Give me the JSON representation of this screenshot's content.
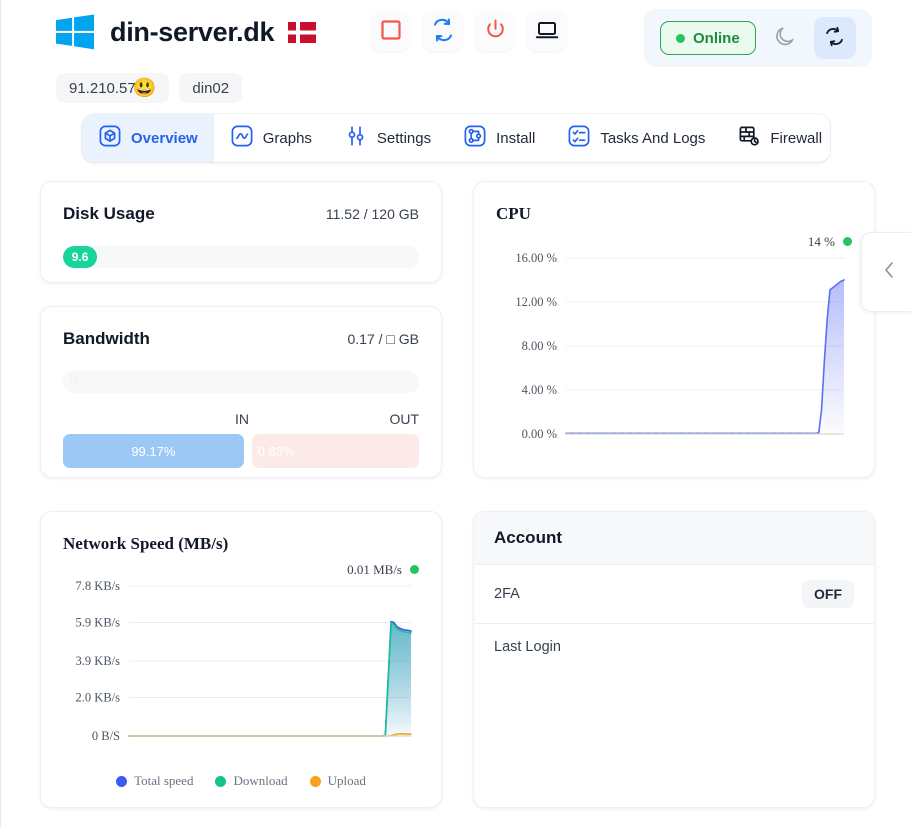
{
  "header": {
    "brand_title": "din-server.dk",
    "logo_icon": "windows-logo",
    "flag_icon": "denmark-flag",
    "actions": [
      {
        "name": "stop-button",
        "icon": "stop-square-icon"
      },
      {
        "name": "restart-button",
        "icon": "restart-icon"
      },
      {
        "name": "power-button",
        "icon": "power-icon"
      },
      {
        "name": "console-button",
        "icon": "monitor-icon"
      }
    ],
    "status": {
      "label": "Online",
      "dot_color": "#22c55e",
      "text_color": "#1c8c3c",
      "dark_mode_icon": "moon-icon",
      "refresh_icon": "sync-icon"
    }
  },
  "chips": [
    {
      "label": "91.210.57",
      "emoji": "😃"
    },
    {
      "label": "din02",
      "emoji": ""
    }
  ],
  "tabs": [
    {
      "label": "Overview",
      "icon": "cube-icon",
      "active": true
    },
    {
      "label": "Graphs",
      "icon": "wave-icon",
      "active": false
    },
    {
      "label": "Settings",
      "icon": "sliders-icon",
      "active": false
    },
    {
      "label": "Install",
      "icon": "nodes-icon",
      "active": false
    },
    {
      "label": "Tasks And Logs",
      "icon": "checklist-icon",
      "active": false
    },
    {
      "label": "Firewall",
      "icon": "firewall-icon",
      "active": false
    }
  ],
  "tab_caret_icon": "chevron-down-icon",
  "disk": {
    "title": "Disk Usage",
    "value": "11.52 / 120 GB",
    "bar_label": "9.6",
    "percent": 9.6,
    "bar_color": "#18d498"
  },
  "bandwidth": {
    "title": "Bandwidth",
    "value": "0.17 / □ GB",
    "track_label": "0",
    "percent": 0,
    "in_label": "IN",
    "out_label": "OUT",
    "in_value": "99.17%",
    "out_value": "0.83%",
    "in_percent": 99.17,
    "out_percent": 0.83,
    "in_color": "#9cc8f5",
    "out_color": "#fbeae8"
  },
  "account": {
    "title": "Account",
    "rows": [
      {
        "label": "2FA",
        "value": "OFF"
      },
      {
        "label": "Last Login",
        "value": ""
      }
    ]
  },
  "drawer": {
    "icon": "chevron-left-icon"
  },
  "chart_data": [
    {
      "type": "area",
      "name": "cpu",
      "title": "CPU",
      "current_label": "14 %",
      "current_value": 14,
      "dot_color": "#22c55e",
      "line_color": "#5b6ef5",
      "fill_color": "#c7cffa",
      "ylabel": "",
      "xlabel": "",
      "ylim": [
        0,
        16
      ],
      "ytick_labels": [
        "0.00 %",
        "4.00 %",
        "8.00 %",
        "12.00 %",
        "16.00 %"
      ],
      "yticks": [
        0,
        4,
        8,
        12,
        16
      ],
      "grid": true,
      "legend": null,
      "series": [
        {
          "name": "CPU usage",
          "values": [
            0.05,
            0.05,
            0.06,
            0.05,
            0.05,
            0.06,
            0.05,
            0.05,
            0.06,
            0.05,
            0.05,
            0.06,
            0.05,
            0.05,
            0.06,
            0.05,
            0.05,
            0.06,
            0.05,
            0.05,
            0.06,
            0.05,
            0.05,
            0.06,
            0.05,
            0.05,
            0.06,
            0.05,
            0.05,
            0.06,
            0.05,
            0.05,
            0.06,
            0.05,
            0.05,
            0.06,
            0.05,
            0.05,
            0.06,
            0.05,
            0.05,
            0.06,
            0.05,
            0.05,
            0.06,
            0.05,
            0.05,
            0.06,
            0.05,
            0.05,
            0.06,
            0.05,
            0.05,
            0.06,
            0.05,
            0.05,
            0.06,
            0.05,
            0.05,
            0.06,
            0.05,
            0.05,
            0.06,
            0.05,
            0.05,
            0.06,
            0.05,
            0.05,
            0.06,
            0.05,
            0.05,
            0.06,
            0.05,
            0.05,
            0.06,
            0.05,
            0.05,
            0.06,
            0.05,
            0.05,
            0.06,
            0.05,
            0.05,
            0.06,
            0.05,
            0.05,
            0.06,
            0.05,
            0.05,
            0.06,
            0.1,
            2.2,
            6.6,
            10.4,
            13.1,
            13.3,
            13.5,
            13.7,
            13.9,
            14.0
          ]
        }
      ]
    },
    {
      "type": "area",
      "name": "network-speed",
      "title": "Network Speed (MB/s)",
      "current_label": "0.01 MB/s",
      "current_value": 0.01,
      "dot_color": "#22c55e",
      "ylabel": "",
      "xlabel": "",
      "ylim": [
        0,
        7.8
      ],
      "ytick_labels": [
        "0 B/S",
        "2.0 KB/s",
        "3.9 KB/s",
        "5.9 KB/s",
        "7.8 KB/s"
      ],
      "yticks": [
        0,
        2.0,
        3.9,
        5.9,
        7.8
      ],
      "grid": true,
      "legend": [
        {
          "label": "Total speed",
          "color": "#3b5bf5"
        },
        {
          "label": "Download",
          "color": "#14c38e"
        },
        {
          "label": "Upload",
          "color": "#f5a21e"
        }
      ],
      "series": [
        {
          "name": "Total speed",
          "color": "#3b5bf5",
          "values": [
            0,
            0,
            0,
            0,
            0,
            0,
            0,
            0,
            0,
            0,
            0,
            0,
            0,
            0,
            0,
            0,
            0,
            0,
            0,
            0,
            0,
            0,
            0,
            0,
            0,
            0,
            0,
            0,
            0,
            0,
            0,
            0,
            0,
            0,
            0,
            0,
            0,
            0,
            0,
            0,
            0,
            0,
            0,
            0,
            0,
            0,
            0,
            0,
            0,
            0,
            0,
            0,
            0,
            0,
            0,
            0,
            0,
            0,
            0,
            0,
            0,
            0,
            0,
            0,
            0,
            0,
            0,
            0,
            0,
            0,
            0,
            0,
            0,
            0,
            0,
            0,
            0,
            0,
            0,
            0,
            0,
            0,
            0,
            0,
            0,
            0,
            0,
            0,
            0,
            0,
            0.05,
            3.0,
            5.95,
            5.9,
            5.7,
            5.6,
            5.55,
            5.5,
            5.5,
            5.45
          ]
        },
        {
          "name": "Download",
          "color": "#14c38e",
          "values": [
            0,
            0,
            0,
            0,
            0,
            0,
            0,
            0,
            0,
            0,
            0,
            0,
            0,
            0,
            0,
            0,
            0,
            0,
            0,
            0,
            0,
            0,
            0,
            0,
            0,
            0,
            0,
            0,
            0,
            0,
            0,
            0,
            0,
            0,
            0,
            0,
            0,
            0,
            0,
            0,
            0,
            0,
            0,
            0,
            0,
            0,
            0,
            0,
            0,
            0,
            0,
            0,
            0,
            0,
            0,
            0,
            0,
            0,
            0,
            0,
            0,
            0,
            0,
            0,
            0,
            0,
            0,
            0,
            0,
            0,
            0,
            0,
            0,
            0,
            0,
            0,
            0,
            0,
            0,
            0,
            0,
            0,
            0,
            0,
            0,
            0,
            0,
            0,
            0,
            0,
            0.05,
            2.95,
            5.9,
            5.8,
            5.6,
            5.5,
            5.45,
            5.4,
            5.4,
            5.35
          ]
        },
        {
          "name": "Upload",
          "color": "#f5a21e",
          "values": [
            0,
            0,
            0,
            0,
            0,
            0,
            0,
            0,
            0,
            0,
            0,
            0,
            0,
            0,
            0,
            0,
            0,
            0,
            0,
            0,
            0,
            0,
            0,
            0,
            0,
            0,
            0,
            0,
            0,
            0,
            0,
            0,
            0,
            0,
            0,
            0,
            0,
            0,
            0,
            0,
            0,
            0,
            0,
            0,
            0,
            0,
            0,
            0,
            0,
            0,
            0,
            0,
            0,
            0,
            0,
            0,
            0,
            0,
            0,
            0,
            0,
            0,
            0,
            0,
            0,
            0,
            0,
            0,
            0,
            0,
            0,
            0,
            0,
            0,
            0,
            0,
            0,
            0,
            0,
            0,
            0,
            0,
            0,
            0,
            0,
            0,
            0,
            0,
            0,
            0,
            0,
            0,
            0.02,
            0.06,
            0.1,
            0.12,
            0.12,
            0.11,
            0.1,
            0.1
          ]
        }
      ]
    }
  ]
}
